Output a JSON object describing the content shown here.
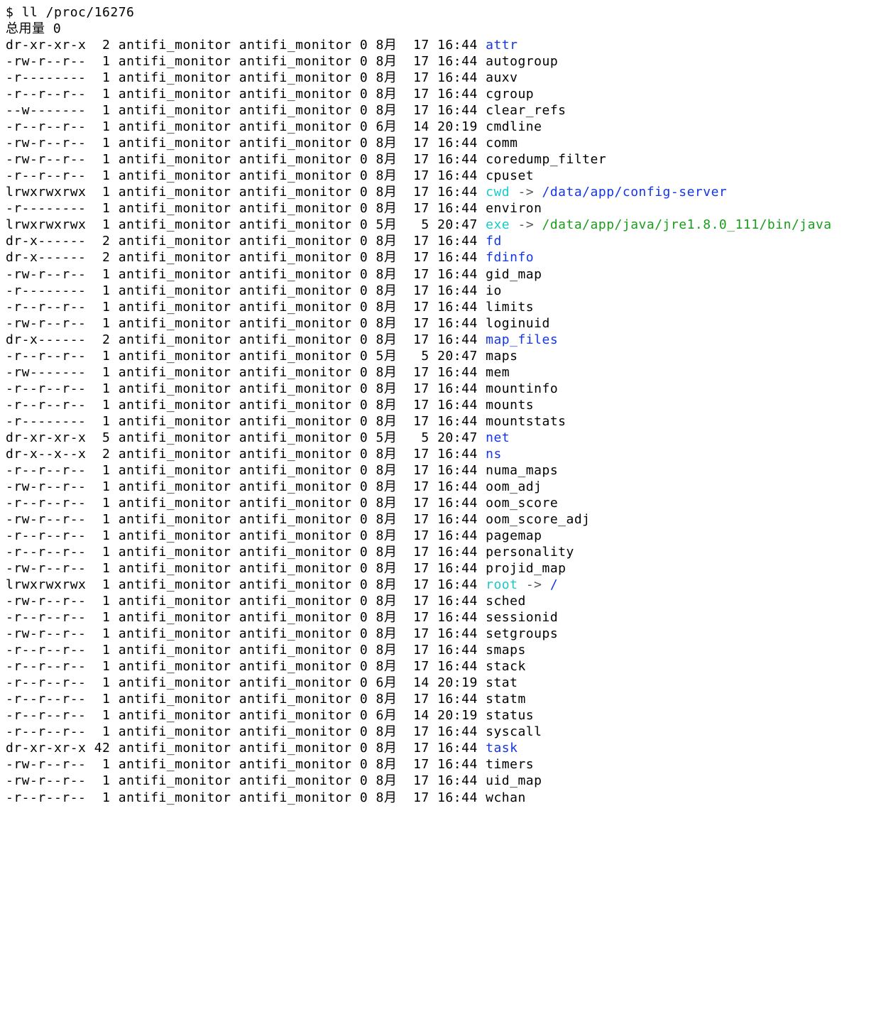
{
  "prompt": "$ ll /proc/16276",
  "total_line": "总用量 0",
  "arrow": " -> ",
  "entries": [
    {
      "perm": "dr-xr-xr-x",
      "links": "2",
      "user": "antifi_monitor",
      "group": "antifi_monitor",
      "size": "0",
      "month": "8月",
      "day": "17",
      "time": "16:44",
      "name": "attr",
      "ntype": "dir"
    },
    {
      "perm": "-rw-r--r--",
      "links": "1",
      "user": "antifi_monitor",
      "group": "antifi_monitor",
      "size": "0",
      "month": "8月",
      "day": "17",
      "time": "16:44",
      "name": "autogroup",
      "ntype": "plain"
    },
    {
      "perm": "-r--------",
      "links": "1",
      "user": "antifi_monitor",
      "group": "antifi_monitor",
      "size": "0",
      "month": "8月",
      "day": "17",
      "time": "16:44",
      "name": "auxv",
      "ntype": "plain"
    },
    {
      "perm": "-r--r--r--",
      "links": "1",
      "user": "antifi_monitor",
      "group": "antifi_monitor",
      "size": "0",
      "month": "8月",
      "day": "17",
      "time": "16:44",
      "name": "cgroup",
      "ntype": "plain"
    },
    {
      "perm": "--w-------",
      "links": "1",
      "user": "antifi_monitor",
      "group": "antifi_monitor",
      "size": "0",
      "month": "8月",
      "day": "17",
      "time": "16:44",
      "name": "clear_refs",
      "ntype": "plain"
    },
    {
      "perm": "-r--r--r--",
      "links": "1",
      "user": "antifi_monitor",
      "group": "antifi_monitor",
      "size": "0",
      "month": "6月",
      "day": "14",
      "time": "20:19",
      "name": "cmdline",
      "ntype": "plain"
    },
    {
      "perm": "-rw-r--r--",
      "links": "1",
      "user": "antifi_monitor",
      "group": "antifi_monitor",
      "size": "0",
      "month": "8月",
      "day": "17",
      "time": "16:44",
      "name": "comm",
      "ntype": "plain"
    },
    {
      "perm": "-rw-r--r--",
      "links": "1",
      "user": "antifi_monitor",
      "group": "antifi_monitor",
      "size": "0",
      "month": "8月",
      "day": "17",
      "time": "16:44",
      "name": "coredump_filter",
      "ntype": "plain"
    },
    {
      "perm": "-r--r--r--",
      "links": "1",
      "user": "antifi_monitor",
      "group": "antifi_monitor",
      "size": "0",
      "month": "8月",
      "day": "17",
      "time": "16:44",
      "name": "cpuset",
      "ntype": "plain"
    },
    {
      "perm": "lrwxrwxrwx",
      "links": "1",
      "user": "antifi_monitor",
      "group": "antifi_monitor",
      "size": "0",
      "month": "8月",
      "day": "17",
      "time": "16:44",
      "name": "cwd",
      "ntype": "link",
      "target": "/data/app/config-server",
      "ttype": "dir"
    },
    {
      "perm": "-r--------",
      "links": "1",
      "user": "antifi_monitor",
      "group": "antifi_monitor",
      "size": "0",
      "month": "8月",
      "day": "17",
      "time": "16:44",
      "name": "environ",
      "ntype": "plain"
    },
    {
      "perm": "lrwxrwxrwx",
      "links": "1",
      "user": "antifi_monitor",
      "group": "antifi_monitor",
      "size": "0",
      "month": "5月",
      "day": "5",
      "time": "20:47",
      "name": "exe",
      "ntype": "link",
      "target": "/data/app/java/jre1.8.0_111/bin/java",
      "ttype": "exec"
    },
    {
      "perm": "dr-x------",
      "links": "2",
      "user": "antifi_monitor",
      "group": "antifi_monitor",
      "size": "0",
      "month": "8月",
      "day": "17",
      "time": "16:44",
      "name": "fd",
      "ntype": "dir"
    },
    {
      "perm": "dr-x------",
      "links": "2",
      "user": "antifi_monitor",
      "group": "antifi_monitor",
      "size": "0",
      "month": "8月",
      "day": "17",
      "time": "16:44",
      "name": "fdinfo",
      "ntype": "dir"
    },
    {
      "perm": "-rw-r--r--",
      "links": "1",
      "user": "antifi_monitor",
      "group": "antifi_monitor",
      "size": "0",
      "month": "8月",
      "day": "17",
      "time": "16:44",
      "name": "gid_map",
      "ntype": "plain"
    },
    {
      "perm": "-r--------",
      "links": "1",
      "user": "antifi_monitor",
      "group": "antifi_monitor",
      "size": "0",
      "month": "8月",
      "day": "17",
      "time": "16:44",
      "name": "io",
      "ntype": "plain"
    },
    {
      "perm": "-r--r--r--",
      "links": "1",
      "user": "antifi_monitor",
      "group": "antifi_monitor",
      "size": "0",
      "month": "8月",
      "day": "17",
      "time": "16:44",
      "name": "limits",
      "ntype": "plain"
    },
    {
      "perm": "-rw-r--r--",
      "links": "1",
      "user": "antifi_monitor",
      "group": "antifi_monitor",
      "size": "0",
      "month": "8月",
      "day": "17",
      "time": "16:44",
      "name": "loginuid",
      "ntype": "plain"
    },
    {
      "perm": "dr-x------",
      "links": "2",
      "user": "antifi_monitor",
      "group": "antifi_monitor",
      "size": "0",
      "month": "8月",
      "day": "17",
      "time": "16:44",
      "name": "map_files",
      "ntype": "dir"
    },
    {
      "perm": "-r--r--r--",
      "links": "1",
      "user": "antifi_monitor",
      "group": "antifi_monitor",
      "size": "0",
      "month": "5月",
      "day": "5",
      "time": "20:47",
      "name": "maps",
      "ntype": "plain"
    },
    {
      "perm": "-rw-------",
      "links": "1",
      "user": "antifi_monitor",
      "group": "antifi_monitor",
      "size": "0",
      "month": "8月",
      "day": "17",
      "time": "16:44",
      "name": "mem",
      "ntype": "plain"
    },
    {
      "perm": "-r--r--r--",
      "links": "1",
      "user": "antifi_monitor",
      "group": "antifi_monitor",
      "size": "0",
      "month": "8月",
      "day": "17",
      "time": "16:44",
      "name": "mountinfo",
      "ntype": "plain"
    },
    {
      "perm": "-r--r--r--",
      "links": "1",
      "user": "antifi_monitor",
      "group": "antifi_monitor",
      "size": "0",
      "month": "8月",
      "day": "17",
      "time": "16:44",
      "name": "mounts",
      "ntype": "plain"
    },
    {
      "perm": "-r--------",
      "links": "1",
      "user": "antifi_monitor",
      "group": "antifi_monitor",
      "size": "0",
      "month": "8月",
      "day": "17",
      "time": "16:44",
      "name": "mountstats",
      "ntype": "plain"
    },
    {
      "perm": "dr-xr-xr-x",
      "links": "5",
      "user": "antifi_monitor",
      "group": "antifi_monitor",
      "size": "0",
      "month": "5月",
      "day": "5",
      "time": "20:47",
      "name": "net",
      "ntype": "dir"
    },
    {
      "perm": "dr-x--x--x",
      "links": "2",
      "user": "antifi_monitor",
      "group": "antifi_monitor",
      "size": "0",
      "month": "8月",
      "day": "17",
      "time": "16:44",
      "name": "ns",
      "ntype": "dir"
    },
    {
      "perm": "-r--r--r--",
      "links": "1",
      "user": "antifi_monitor",
      "group": "antifi_monitor",
      "size": "0",
      "month": "8月",
      "day": "17",
      "time": "16:44",
      "name": "numa_maps",
      "ntype": "plain"
    },
    {
      "perm": "-rw-r--r--",
      "links": "1",
      "user": "antifi_monitor",
      "group": "antifi_monitor",
      "size": "0",
      "month": "8月",
      "day": "17",
      "time": "16:44",
      "name": "oom_adj",
      "ntype": "plain"
    },
    {
      "perm": "-r--r--r--",
      "links": "1",
      "user": "antifi_monitor",
      "group": "antifi_monitor",
      "size": "0",
      "month": "8月",
      "day": "17",
      "time": "16:44",
      "name": "oom_score",
      "ntype": "plain"
    },
    {
      "perm": "-rw-r--r--",
      "links": "1",
      "user": "antifi_monitor",
      "group": "antifi_monitor",
      "size": "0",
      "month": "8月",
      "day": "17",
      "time": "16:44",
      "name": "oom_score_adj",
      "ntype": "plain"
    },
    {
      "perm": "-r--r--r--",
      "links": "1",
      "user": "antifi_monitor",
      "group": "antifi_monitor",
      "size": "0",
      "month": "8月",
      "day": "17",
      "time": "16:44",
      "name": "pagemap",
      "ntype": "plain"
    },
    {
      "perm": "-r--r--r--",
      "links": "1",
      "user": "antifi_monitor",
      "group": "antifi_monitor",
      "size": "0",
      "month": "8月",
      "day": "17",
      "time": "16:44",
      "name": "personality",
      "ntype": "plain"
    },
    {
      "perm": "-rw-r--r--",
      "links": "1",
      "user": "antifi_monitor",
      "group": "antifi_monitor",
      "size": "0",
      "month": "8月",
      "day": "17",
      "time": "16:44",
      "name": "projid_map",
      "ntype": "plain"
    },
    {
      "perm": "lrwxrwxrwx",
      "links": "1",
      "user": "antifi_monitor",
      "group": "antifi_monitor",
      "size": "0",
      "month": "8月",
      "day": "17",
      "time": "16:44",
      "name": "root",
      "ntype": "link",
      "target": "/",
      "ttype": "dir"
    },
    {
      "perm": "-rw-r--r--",
      "links": "1",
      "user": "antifi_monitor",
      "group": "antifi_monitor",
      "size": "0",
      "month": "8月",
      "day": "17",
      "time": "16:44",
      "name": "sched",
      "ntype": "plain"
    },
    {
      "perm": "-r--r--r--",
      "links": "1",
      "user": "antifi_monitor",
      "group": "antifi_monitor",
      "size": "0",
      "month": "8月",
      "day": "17",
      "time": "16:44",
      "name": "sessionid",
      "ntype": "plain"
    },
    {
      "perm": "-rw-r--r--",
      "links": "1",
      "user": "antifi_monitor",
      "group": "antifi_monitor",
      "size": "0",
      "month": "8月",
      "day": "17",
      "time": "16:44",
      "name": "setgroups",
      "ntype": "plain"
    },
    {
      "perm": "-r--r--r--",
      "links": "1",
      "user": "antifi_monitor",
      "group": "antifi_monitor",
      "size": "0",
      "month": "8月",
      "day": "17",
      "time": "16:44",
      "name": "smaps",
      "ntype": "plain"
    },
    {
      "perm": "-r--r--r--",
      "links": "1",
      "user": "antifi_monitor",
      "group": "antifi_monitor",
      "size": "0",
      "month": "8月",
      "day": "17",
      "time": "16:44",
      "name": "stack",
      "ntype": "plain"
    },
    {
      "perm": "-r--r--r--",
      "links": "1",
      "user": "antifi_monitor",
      "group": "antifi_monitor",
      "size": "0",
      "month": "6月",
      "day": "14",
      "time": "20:19",
      "name": "stat",
      "ntype": "plain"
    },
    {
      "perm": "-r--r--r--",
      "links": "1",
      "user": "antifi_monitor",
      "group": "antifi_monitor",
      "size": "0",
      "month": "8月",
      "day": "17",
      "time": "16:44",
      "name": "statm",
      "ntype": "plain"
    },
    {
      "perm": "-r--r--r--",
      "links": "1",
      "user": "antifi_monitor",
      "group": "antifi_monitor",
      "size": "0",
      "month": "6月",
      "day": "14",
      "time": "20:19",
      "name": "status",
      "ntype": "plain"
    },
    {
      "perm": "-r--r--r--",
      "links": "1",
      "user": "antifi_monitor",
      "group": "antifi_monitor",
      "size": "0",
      "month": "8月",
      "day": "17",
      "time": "16:44",
      "name": "syscall",
      "ntype": "plain"
    },
    {
      "perm": "dr-xr-xr-x",
      "links": "42",
      "user": "antifi_monitor",
      "group": "antifi_monitor",
      "size": "0",
      "month": "8月",
      "day": "17",
      "time": "16:44",
      "name": "task",
      "ntype": "dir"
    },
    {
      "perm": "-rw-r--r--",
      "links": "1",
      "user": "antifi_monitor",
      "group": "antifi_monitor",
      "size": "0",
      "month": "8月",
      "day": "17",
      "time": "16:44",
      "name": "timers",
      "ntype": "plain"
    },
    {
      "perm": "-rw-r--r--",
      "links": "1",
      "user": "antifi_monitor",
      "group": "antifi_monitor",
      "size": "0",
      "month": "8月",
      "day": "17",
      "time": "16:44",
      "name": "uid_map",
      "ntype": "plain"
    },
    {
      "perm": "-r--r--r--",
      "links": "1",
      "user": "antifi_monitor",
      "group": "antifi_monitor",
      "size": "0",
      "month": "8月",
      "day": "17",
      "time": "16:44",
      "name": "wchan",
      "ntype": "plain"
    }
  ]
}
